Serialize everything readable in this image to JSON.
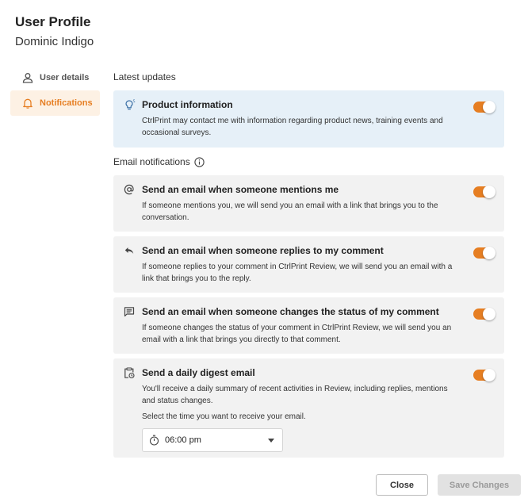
{
  "header": {
    "title": "User Profile",
    "user_name": "Dominic Indigo"
  },
  "nav": {
    "items": [
      {
        "label": "User details",
        "icon": "person-icon",
        "active": false
      },
      {
        "label": "Notifications",
        "icon": "bell-icon",
        "active": true
      }
    ]
  },
  "latest_updates": {
    "heading": "Latest updates",
    "product": {
      "icon": "lightbulb-icon",
      "title": "Product information",
      "desc": "CtrlPrint may contact me with information regarding product news, training events and occasional surveys.",
      "enabled": true
    }
  },
  "email_notifications": {
    "heading": "Email notifications",
    "info_icon": "info-icon",
    "items": [
      {
        "icon": "at-sign-icon",
        "title": "Send an email when someone mentions me",
        "desc": "If someone mentions you, we will send you an email with a link that brings you to the conversation.",
        "enabled": true
      },
      {
        "icon": "reply-icon",
        "title": "Send an email when someone replies to my comment",
        "desc": "If someone replies to your comment in CtrlPrint Review, we will send you an email with a link that brings you to the reply.",
        "enabled": true
      },
      {
        "icon": "comment-icon",
        "title": "Send an email when someone changes the status of my comment",
        "desc": "If someone changes the status of your comment in CtrlPrint Review, we will send you an email with a link that brings you directly to that comment.",
        "enabled": true
      }
    ],
    "digest": {
      "icon": "clipboard-clock-icon",
      "title": "Send a daily digest email",
      "desc": "You'll receive a daily summary of recent activities in Review, including replies, mentions and status changes.",
      "time_prompt": "Select the time you want to receive your email.",
      "time_value": "06:00 pm",
      "enabled": true
    }
  },
  "footer": {
    "close_label": "Close",
    "save_label": "Save Changes"
  },
  "colors": {
    "accent": "#e67e22",
    "active_nav_bg": "#fdf1e4",
    "info_card_bg": "#e6f0f8",
    "card_bg": "#f2f2f2"
  }
}
